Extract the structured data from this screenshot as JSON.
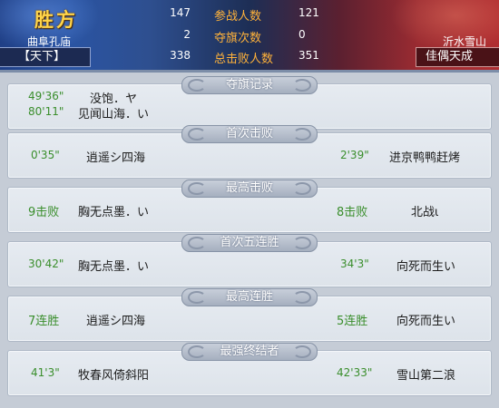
{
  "header": {
    "result_title": "胜方",
    "left_team": {
      "server": "曲阜孔庙",
      "name": "【天下】"
    },
    "right_team": {
      "server": "沂水雪山",
      "name": "佳偶天成"
    },
    "stats": [
      {
        "label": "参战人数",
        "left": "147",
        "right": "121"
      },
      {
        "label": "夺旗次数",
        "left": "2",
        "right": "0"
      },
      {
        "label": "总击败人数",
        "left": "338",
        "right": "351"
      }
    ]
  },
  "sections": [
    {
      "title": "夺旗记录",
      "left_lines": [
        {
          "value": "49'36\"",
          "player": "没饱．ヤ"
        },
        {
          "value": "80'11\"",
          "player": "见闻山海．い"
        }
      ],
      "right_lines": []
    },
    {
      "title": "首次击败",
      "left_lines": [
        {
          "value": "0'35\"",
          "player": "逍遥シ四海"
        }
      ],
      "right_lines": [
        {
          "value": "2'39\"",
          "player": "进京鸭鸭赶烤"
        }
      ]
    },
    {
      "title": "最高击败",
      "left_lines": [
        {
          "value": "9击败",
          "player": "胸无点墨．い"
        }
      ],
      "right_lines": [
        {
          "value": "8击败",
          "player": "北战ι"
        }
      ]
    },
    {
      "title": "首次五连胜",
      "left_lines": [
        {
          "value": "30'42\"",
          "player": "胸无点墨．い"
        }
      ],
      "right_lines": [
        {
          "value": "34'3\"",
          "player": "向死而生い"
        }
      ]
    },
    {
      "title": "最高连胜",
      "left_lines": [
        {
          "value": "7连胜",
          "player": "逍遥シ四海"
        }
      ],
      "right_lines": [
        {
          "value": "5连胜",
          "player": "向死而生い"
        }
      ]
    },
    {
      "title": "最强终结者",
      "left_lines": [
        {
          "value": "41'3\"",
          "player": "牧春风倚斜阳"
        }
      ],
      "right_lines": [
        {
          "value": "42'33\"",
          "player": "雪山第二浪"
        }
      ]
    }
  ],
  "colors": {
    "title_gold": "#ffd54a",
    "stat_label": "#ffb23a",
    "value_green": "#3a8e2c",
    "left_team_blue": "#1f3f86",
    "right_team_red": "#b02e31"
  }
}
